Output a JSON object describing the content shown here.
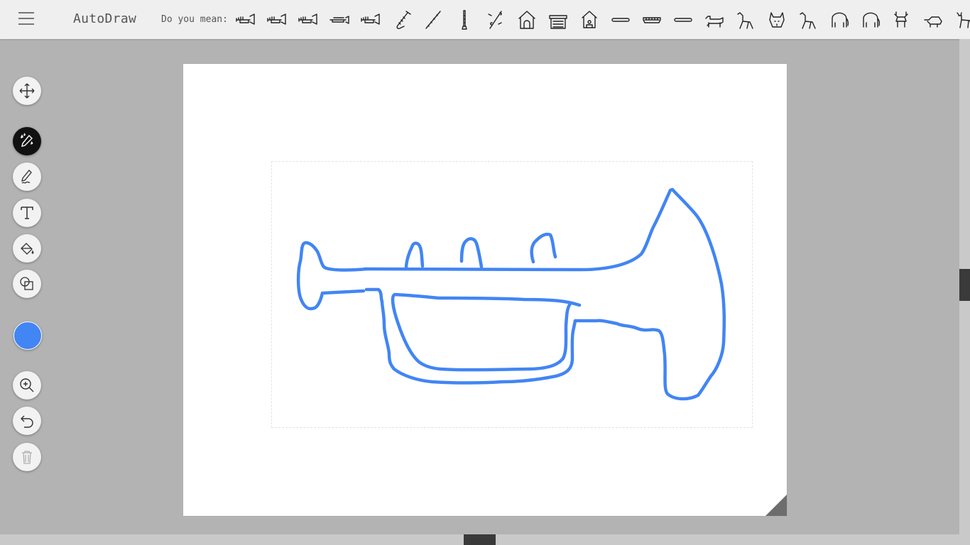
{
  "app": {
    "title": "AutoDraw"
  },
  "suggestions": {
    "label": "Do you mean:",
    "items": [
      "trumpet-icon",
      "trumpet-icon",
      "trumpet-icon",
      "trombone-icon",
      "trumpet-icon",
      "saxophone-icon",
      "flute-icon",
      "clarinet-icon",
      "music-notes-icon",
      "doghouse-icon",
      "barn-icon",
      "birdhouse-icon",
      "hot-dog-icon",
      "hot-dog-bun-icon",
      "hot-dog-icon",
      "dachshund-icon",
      "dog-icon",
      "dog-face-icon",
      "dog-icon",
      "elephant-icon",
      "elephant-icon",
      "moose-icon",
      "anteater-icon",
      "goat-icon"
    ]
  },
  "tools": {
    "move": "move-icon",
    "autodraw": "autodraw-icon",
    "draw": "pencil-icon",
    "type": "text-icon",
    "fill": "fill-icon",
    "shape": "shape-icon",
    "zoom": "zoom-in-icon",
    "undo": "undo-icon",
    "delete": "trash-icon"
  },
  "colors": {
    "stroke": "#4285f4",
    "selected_color": "#4285f4",
    "background": "#b3b3b3"
  }
}
